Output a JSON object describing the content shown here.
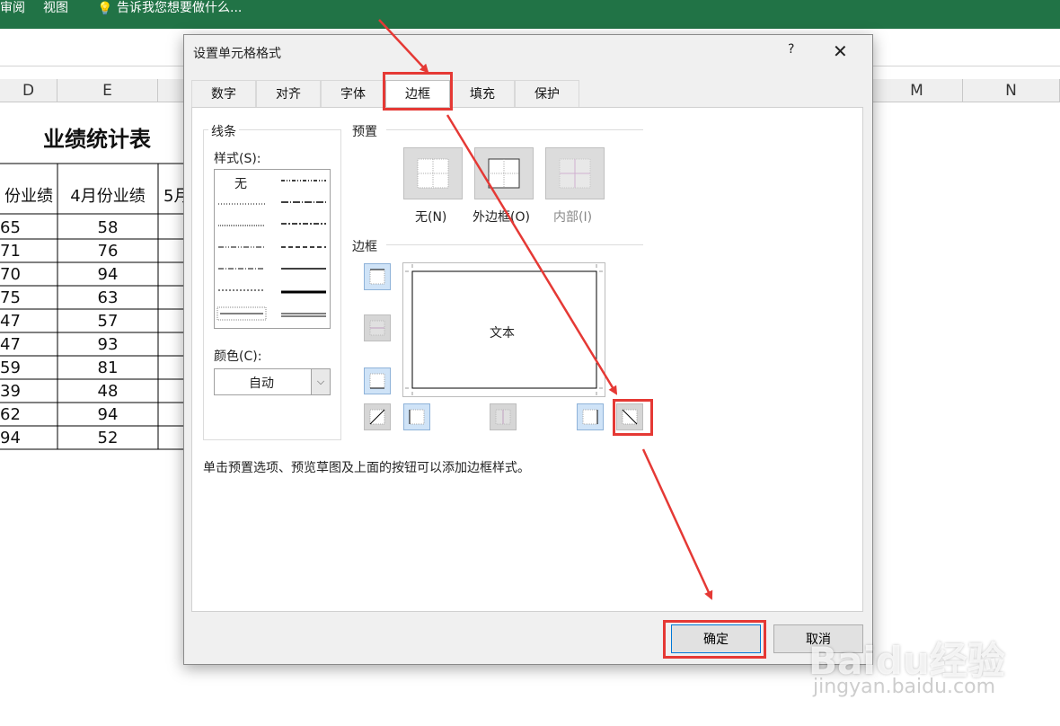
{
  "ribbon": {
    "tab_review": "审阅",
    "tab_view": "视图",
    "tell_me": "告诉我您想要做什么..."
  },
  "sheet": {
    "col_headers": [
      "D",
      "E",
      "",
      "M",
      "N"
    ],
    "title": "业绩统计表",
    "headers": [
      "份业绩",
      "4月份业绩",
      "5月"
    ],
    "rows": [
      [
        "65",
        "58"
      ],
      [
        "71",
        "76"
      ],
      [
        "70",
        "94"
      ],
      [
        "75",
        "63"
      ],
      [
        "47",
        "57"
      ],
      [
        "47",
        "93"
      ],
      [
        "59",
        "81"
      ],
      [
        "39",
        "48"
      ],
      [
        "62",
        "94"
      ],
      [
        "94",
        "52"
      ]
    ]
  },
  "dialog": {
    "title": "设置单元格格式",
    "help": "?",
    "close": "✕",
    "tabs": [
      "数字",
      "对齐",
      "字体",
      "边框",
      "填充",
      "保护"
    ],
    "active_tab": "边框",
    "line_group": "线条",
    "style_label": "样式(S):",
    "none_style": "无",
    "color_label": "颜色(C):",
    "color_value": "自动",
    "preset_label": "预置",
    "preset_none": "无(N)",
    "preset_outline": "外边框(O)",
    "preset_inside": "内部(I)",
    "border_label": "边框",
    "preview_text": "文本",
    "hint": "单击预置选项、预览草图及上面的按钮可以添加边框样式。",
    "ok": "确定",
    "cancel": "取消"
  },
  "watermark": {
    "brand": "Baidu经验",
    "url": "jingyan.baidu.com"
  },
  "colors": {
    "excel_green": "#217346",
    "annotation_red": "#e53935",
    "select_blue": "#cfe3f7"
  }
}
